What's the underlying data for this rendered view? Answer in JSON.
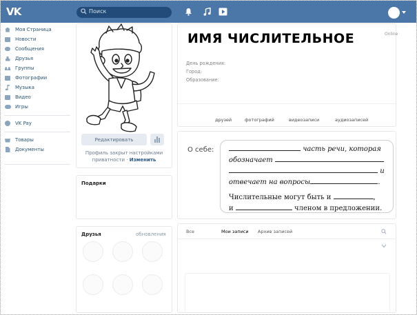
{
  "header": {
    "logo": "VK",
    "search_placeholder": "Поиск",
    "icons": [
      "bell-icon",
      "music-note-icon",
      "video-play-icon"
    ]
  },
  "sidebar": {
    "items": [
      {
        "label": "Моя Страница",
        "icon": "home-icon"
      },
      {
        "label": "Новости",
        "icon": "news-icon"
      },
      {
        "label": "Сообщения",
        "icon": "messages-icon"
      },
      {
        "label": "Друзья",
        "icon": "friend-icon"
      },
      {
        "label": "Группы",
        "icon": "groups-icon"
      },
      {
        "label": "Фотографии",
        "icon": "photo-icon"
      },
      {
        "label": "Музыка",
        "icon": "music-icon"
      },
      {
        "label": "Видео",
        "icon": "video-icon"
      },
      {
        "label": "Игры",
        "icon": "games-icon"
      }
    ],
    "pay": {
      "label": "VK Pay",
      "icon": "vkpay-icon"
    },
    "extra": [
      {
        "label": "Товары",
        "icon": "goods-icon"
      },
      {
        "label": "Документы",
        "icon": "documents-icon"
      }
    ]
  },
  "profile": {
    "edit_label": "Редактировать",
    "closed_text": "Профиль закрыт настройками приватности",
    "closed_sep": "·",
    "change_label": "Изменить",
    "gifts_title": "Подарки",
    "friends_title": "Друзья",
    "friends_updates": "обновления"
  },
  "user": {
    "name": "ИМЯ ЧИСЛИТЕЛЬНОЕ",
    "status": "Online",
    "info_labels": [
      "День рождения:",
      "Город:",
      "Образование:"
    ],
    "counters": [
      "друзей",
      "фотографий",
      "видеозаписи",
      "аудиозаписей"
    ]
  },
  "about": {
    "label": "О себе:",
    "l1": "часть речи, которая",
    "l2": "обозначает",
    "l3": "и",
    "l4": "отвечает на вопросы",
    "l4_end": ".",
    "l5": "Числительные могут быть и",
    "l5_end": ",",
    "l6_start": "и",
    "l6": "членом в предложении."
  },
  "wall": {
    "tabs": [
      "Все",
      "Мои записи",
      "Архив записей"
    ]
  },
  "colors": {
    "topbar": "#4a76a8",
    "link": "#2a5885"
  }
}
